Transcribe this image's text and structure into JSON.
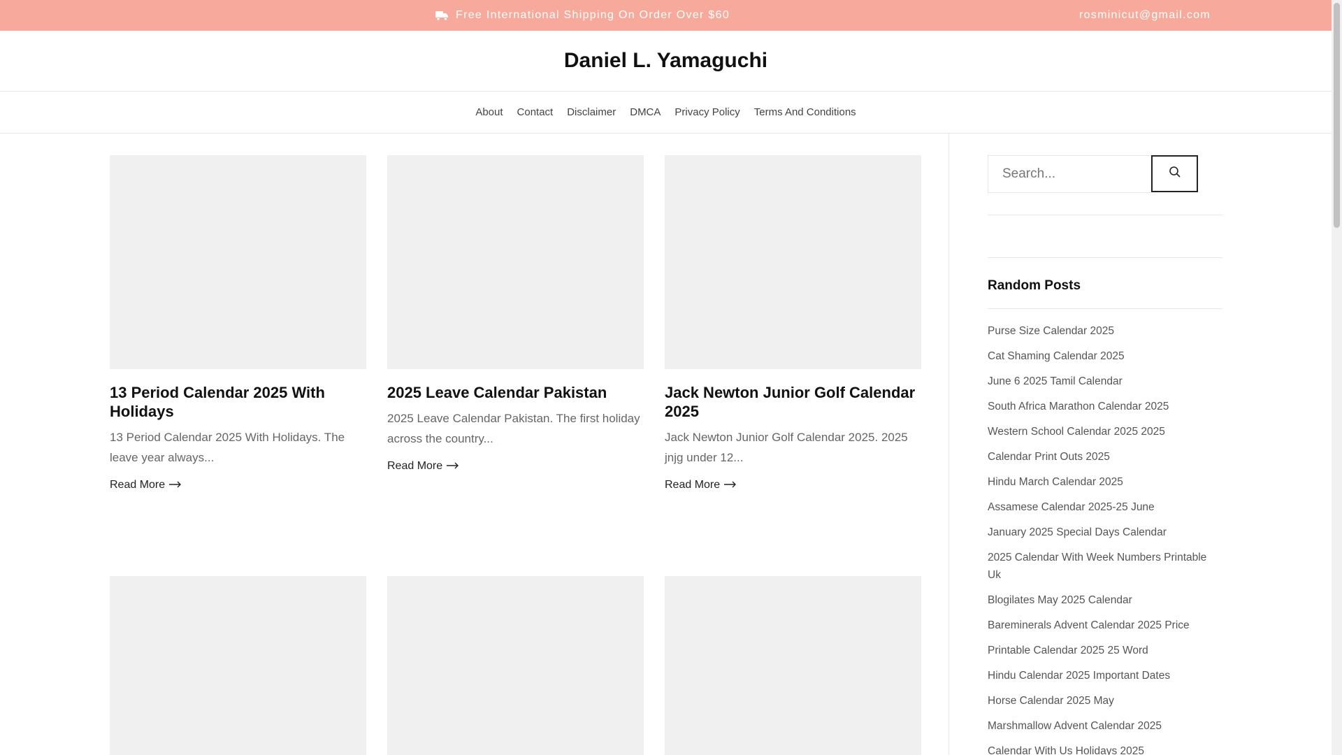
{
  "topbar": {
    "shipping_text": "Free International Shipping On Order Over $60",
    "shipping_icon": "truck-icon",
    "email": "rosminicut@gmail.com",
    "background": "#f7aa9c"
  },
  "site_title": "Daniel L. Yamaguchi",
  "nav": [
    "About",
    "Contact",
    "Disclaimer",
    "DMCA",
    "Privacy Policy",
    "Terms And Conditions"
  ],
  "posts": [
    {
      "title": "13 Period Calendar 2025 With Holidays",
      "excerpt": "13 Period Calendar 2025 With Holidays. The leave year always...",
      "read_more": "Read More"
    },
    {
      "title": "2025 Leave Calendar Pakistan",
      "excerpt": "2025 Leave Calendar Pakistan. The first holiday across the country...",
      "read_more": "Read More"
    },
    {
      "title": "Jack Newton Junior Golf Calendar 2025",
      "excerpt": "Jack Newton Junior Golf Calendar 2025. 2025 jnjg under 12...",
      "read_more": "Read More"
    }
  ],
  "search": {
    "placeholder": "Search...",
    "button_icon": "search-icon"
  },
  "sidebar": {
    "random_posts_title": "Random Posts",
    "random_posts": [
      "Purse Size Calendar 2025",
      "Cat Shaming Calendar 2025",
      "June 6 2025 Tamil Calendar",
      "South Africa Marathon Calendar 2025",
      "Western School Calendar 2025 2025",
      "Calendar Print Outs 2025",
      "Hindu March Calendar 2025",
      "Assamese Calendar 2025-25 June",
      "January 2025 Special Days Calendar",
      "2025 Calendar With Week Numbers Printable Uk",
      "Blogilates May 2025 Calendar",
      "Bareminerals Advent Calendar 2025 Price",
      "Printable Calendar 2025 25 Word",
      "Hindu Calendar 2025 Important Dates",
      "Horse Calendar 2025 May",
      "Marshmallow Advent Calendar 2025",
      "Calendar With Us Holidays 2025"
    ]
  }
}
